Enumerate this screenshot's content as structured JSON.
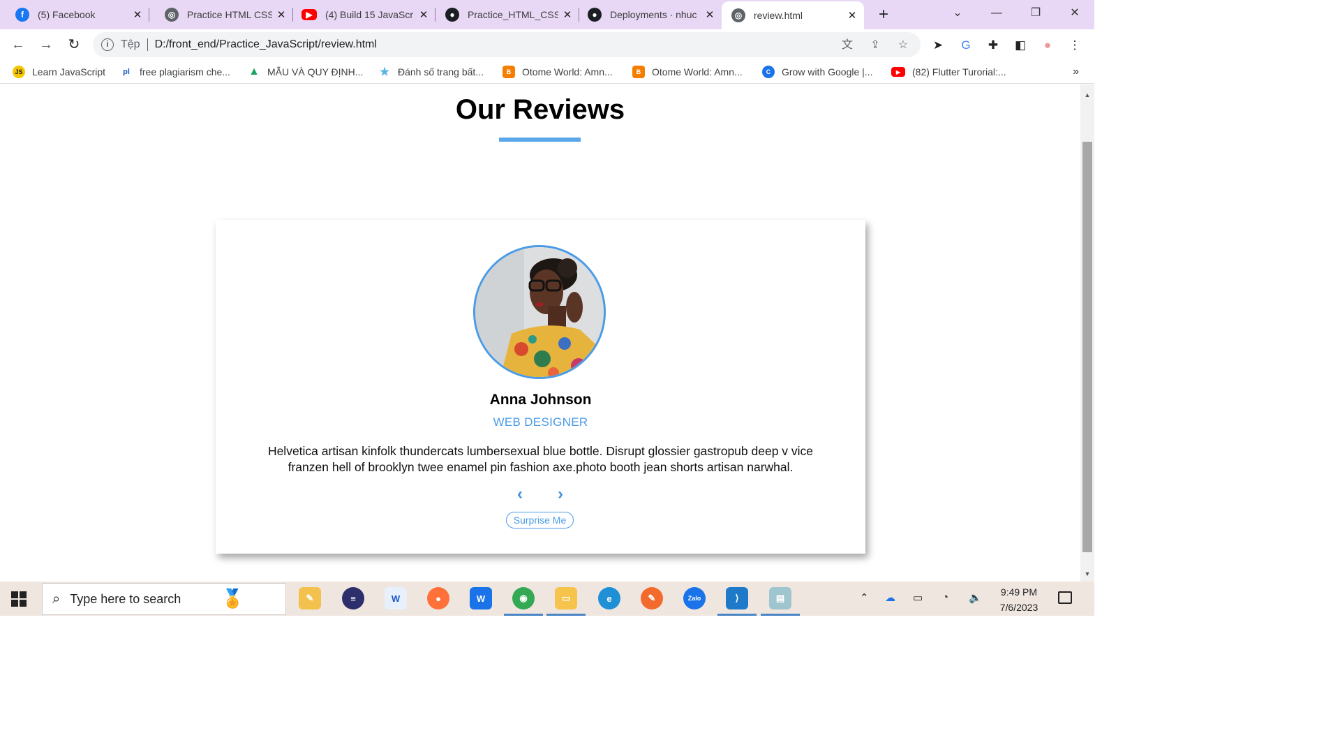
{
  "browser": {
    "tabs": [
      {
        "title": "(5) Facebook",
        "icon": "facebook-icon"
      },
      {
        "title": "Practice HTML CSS",
        "icon": "globe-icon"
      },
      {
        "title": "(4) Build 15 JavaScr",
        "icon": "youtube-icon"
      },
      {
        "title": "Practice_HTML_CSS",
        "icon": "github-icon"
      },
      {
        "title": "Deployments · nhuc",
        "icon": "github-icon"
      },
      {
        "title": "review.html",
        "icon": "globe-icon"
      }
    ],
    "address": {
      "scheme_label": "Tệp",
      "url": "D:/front_end/Practice_JavaScript/review.html"
    },
    "bookmarks": [
      {
        "label": "Learn JavaScript",
        "icon": "js-icon"
      },
      {
        "label": "free plagiarism che...",
        "icon": "pl-icon"
      },
      {
        "label": "MẪU VÀ QUY ĐỊNH...",
        "icon": "drive-icon"
      },
      {
        "label": "Đánh số trang bất...",
        "icon": "star-icon"
      },
      {
        "label": "Otome World: Amn...",
        "icon": "blogger-icon"
      },
      {
        "label": "Otome World: Amn...",
        "icon": "blogger-icon"
      },
      {
        "label": "Grow with Google |...",
        "icon": "google-icon"
      },
      {
        "label": "(82) Flutter Turorial:...",
        "icon": "youtube-icon"
      }
    ],
    "bookmarks_more": "»"
  },
  "page": {
    "title": "Our Reviews",
    "review": {
      "name": "Anna Johnson",
      "job": "WEB DESIGNER",
      "text": "Helvetica artisan kinfolk thundercats lumbersexual blue bottle. Disrupt glossier gastropub deep v vice franzen hell of brooklyn twee enamel pin fashion axe.photo booth jean shorts artisan narwhal.",
      "prev_symbol": "‹",
      "next_symbol": "›",
      "button_label": "Surprise Me"
    },
    "colors": {
      "accent": "#4a9be6",
      "underline": "#5aa7ec"
    }
  },
  "taskbar": {
    "search_placeholder": "Type here to search",
    "time": "9:49 PM",
    "date": "7/6/2023"
  }
}
